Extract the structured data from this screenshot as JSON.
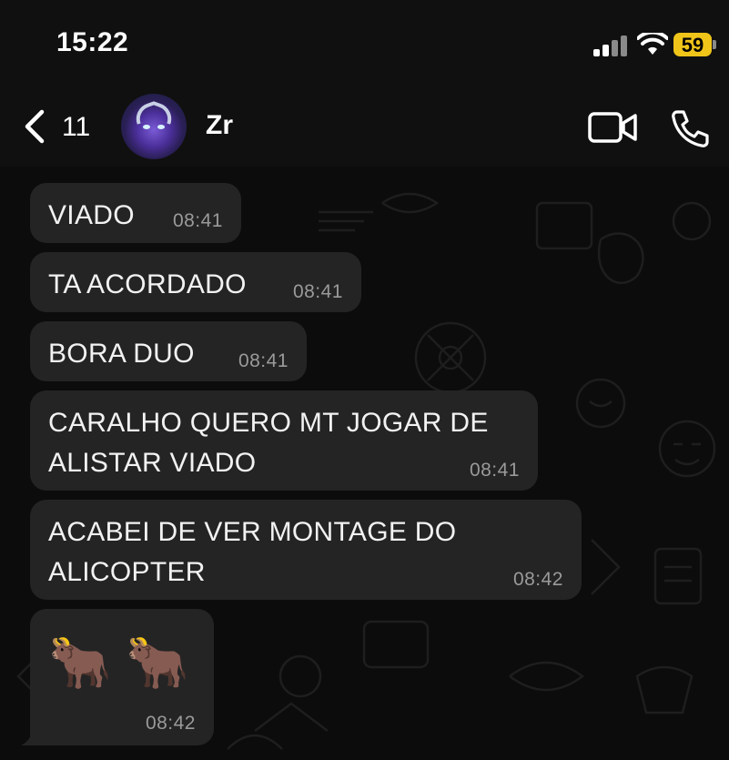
{
  "status_bar": {
    "time": "15:22",
    "battery": "59"
  },
  "header": {
    "unread_count": "11",
    "contact_name": "Zr"
  },
  "messages": [
    {
      "text": "VIADO",
      "time": "08:41"
    },
    {
      "text": "TA ACORDADO",
      "time": "08:41"
    },
    {
      "text": "BORA DUO",
      "time": "08:41"
    },
    {
      "text_line1": "CARALHO QUERO MT JOGAR DE",
      "text_line2": "ALISTAR VIADO",
      "time": "08:41"
    },
    {
      "text_line1": "ACABEI DE VER MONTAGE DO",
      "text_line2": "ALICOPTER",
      "time": "08:42"
    },
    {
      "text": "🐂 🐂",
      "time": "08:42"
    }
  ],
  "icons": [
    "back-chevron-icon",
    "video-call-icon",
    "phone-icon",
    "wifi-icon",
    "signal-icon",
    "battery-icon"
  ],
  "colors": {
    "bubble": "#242424",
    "background": "#0c0c0c",
    "battery": "#f0c419",
    "timestamp": "#9a9a9a"
  }
}
